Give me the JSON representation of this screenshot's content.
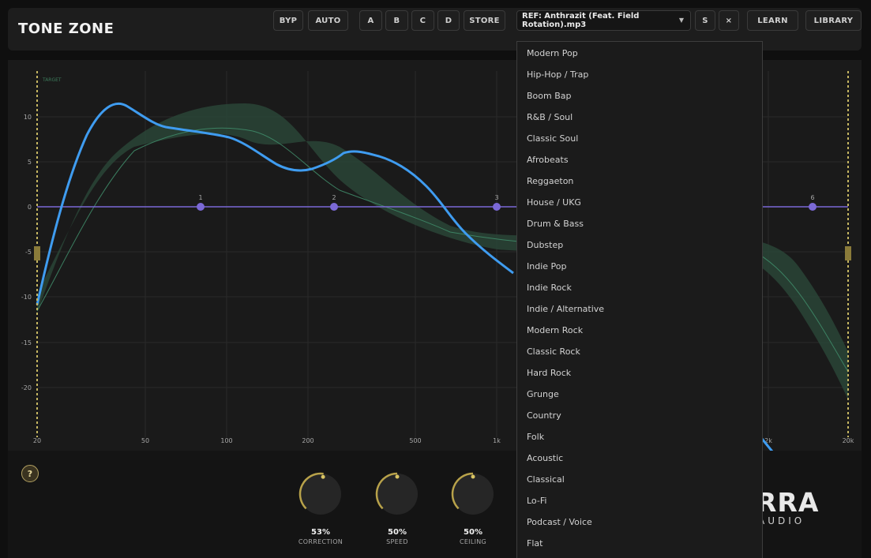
{
  "app": {
    "title": "TONE ZONE"
  },
  "toolbar": {
    "bypass": "BYP",
    "auto": "AUTO",
    "slot_a": "A",
    "slot_b": "B",
    "slot_c": "C",
    "slot_d": "D",
    "store": "STORE",
    "reference_file": "REF: Anthrazit (Feat. Field Rotation).mp3",
    "solo": "S",
    "clear": "×",
    "learn": "LEARN",
    "library": "LIBRARY"
  },
  "graph": {
    "target_label": "TARGET",
    "x_ticks": [
      "20",
      "50",
      "100",
      "200",
      "500",
      "1k",
      "2k",
      "20k"
    ],
    "y_ticks": [
      "10",
      "5",
      "0",
      "-5",
      "-10",
      "-15",
      "-20"
    ],
    "eq_nodes": [
      "1",
      "2",
      "3",
      "6"
    ],
    "colors": {
      "curve": "#3f9cf0",
      "band": "#2c4a3c",
      "eq_line": "#7b69d6",
      "limit": "#c4b561"
    }
  },
  "dropdown": {
    "items": [
      "Modern Pop",
      "Hip-Hop / Trap",
      "Boom Bap",
      "R&B / Soul",
      "Classic Soul",
      "Afrobeats",
      "Reggaeton",
      "House / UKG",
      "Drum & Bass",
      "Dubstep",
      "Indie Pop",
      "Indie Rock",
      "Indie / Alternative",
      "Modern Rock",
      "Classic Rock",
      "Hard Rock",
      "Grunge",
      "Country",
      "Folk",
      "Acoustic",
      "Classical",
      "Lo-Fi",
      "Podcast / Voice",
      "Flat"
    ]
  },
  "controls": {
    "help": "?",
    "knobs": [
      {
        "value": "53%",
        "label": "CORRECTION",
        "level": 0.53
      },
      {
        "value": "50%",
        "label": "SPEED",
        "level": 0.5
      },
      {
        "value": "50%",
        "label": "CEILING",
        "level": 0.5
      }
    ]
  },
  "brand": {
    "logo": "RRA",
    "sub": "AUDIO"
  }
}
